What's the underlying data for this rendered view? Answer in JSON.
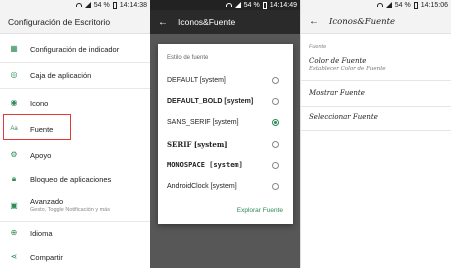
{
  "screen1": {
    "status": {
      "battery": "54 %",
      "time": "14:14:38"
    },
    "title": "Configuración de Escritorio",
    "items": [
      {
        "label": "Configuración de indicador",
        "icon": "grid-icon"
      },
      {
        "label": "Caja de aplicación",
        "icon": "app-drawer-icon"
      },
      {
        "label": "Icono",
        "icon": "icon-shape-icon"
      },
      {
        "label": "Fuente",
        "icon": "font-icon"
      },
      {
        "label": "Apoyo",
        "icon": "gear-icon"
      },
      {
        "label": "Bloqueo de aplicaciones",
        "icon": "lock-icon"
      },
      {
        "label": "Avanzado",
        "sub": "Gesto, Toggle Notificación y más",
        "icon": "advanced-icon"
      },
      {
        "label": "Idioma",
        "icon": "globe-icon"
      },
      {
        "label": "Compartir",
        "icon": "share-icon"
      }
    ],
    "highlight_color": "#e53935"
  },
  "screen2": {
    "status": {
      "battery": "54 %",
      "time": "14:14:49"
    },
    "title": "Iconos&Fuente",
    "dialog": {
      "title": "Estilo de fuente",
      "options": [
        {
          "label": "DEFAULT [system]",
          "bold": false,
          "checked": false
        },
        {
          "label": "DEFAULT_BOLD [system]",
          "bold": true,
          "checked": false
        },
        {
          "label": "SANS_SERIF [system]",
          "bold": false,
          "checked": true
        },
        {
          "label": "SERIF [system]",
          "bold": true,
          "checked": false
        },
        {
          "label": "MONOSPACE [system]",
          "bold": true,
          "checked": false
        },
        {
          "label": "AndroidClock  [system]",
          "bold": false,
          "checked": false
        }
      ],
      "action": "Explorar Fuente"
    }
  },
  "screen3": {
    "status": {
      "battery": "54 %",
      "time": "14:15:06"
    },
    "title": "Iconos&Fuente",
    "section": "Fuente",
    "items": [
      {
        "title": "Color de Fuente",
        "sub": "Establecer Color de Fuente"
      },
      {
        "title": "Mostrar Fuente",
        "sub": ""
      },
      {
        "title": "Seleccionar Fuente",
        "sub": ""
      }
    ]
  },
  "accent_color": "#2e8b57"
}
